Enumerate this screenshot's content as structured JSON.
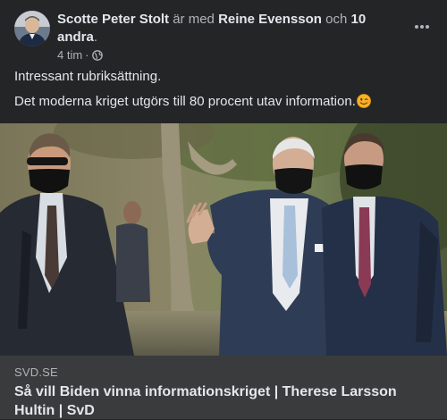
{
  "post": {
    "author": "Scotte Peter Stolt",
    "with_prefix": "är med",
    "tagged": "Reine Evensson",
    "conj": "och",
    "others": "10 andra",
    "period": ".",
    "timestamp": "4 tim",
    "separator": "·",
    "privacy_icon": "globe-icon",
    "more_icon": "more-horizontal-icon",
    "lines": [
      "Intressant rubriksättning.",
      "Det moderna kriget utgörs till 80 procent utav information."
    ],
    "emoji": "winking-face-icon"
  },
  "link": {
    "source": "SVD.SE",
    "title": "Så vill Biden vinna informationskriget | Therese Larsson Hultin | SvD"
  },
  "colors": {
    "background": "#242526",
    "caption_background": "#3a3b3c",
    "primary_text": "#e4e6eb",
    "secondary_text": "#b0b3b8"
  }
}
